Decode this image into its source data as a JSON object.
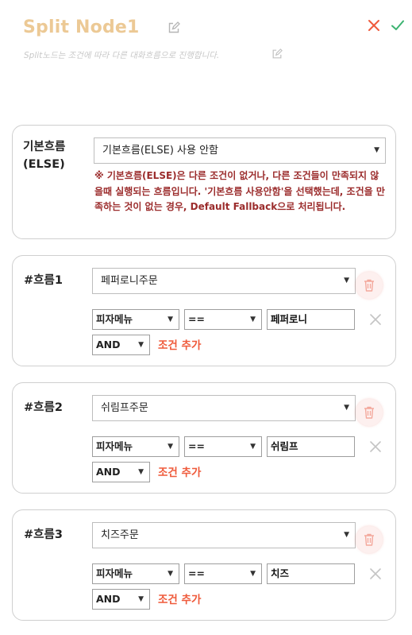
{
  "header": {
    "title": "Split Node1",
    "subtitle": "Split노드는 조건에 따라 다른 대화흐름으로 진행합니다.",
    "icons": {
      "title_edit": "edit-icon",
      "subtitle_edit": "edit-icon",
      "close": "close-icon",
      "confirm": "check-icon"
    },
    "colors": {
      "title": "#ecc995",
      "close": "#ef5a3b",
      "confirm": "#3cb371"
    }
  },
  "default_flow": {
    "label_line1": "기본흐름",
    "label_line2": "(ELSE)",
    "selected": "기본흐름(ELSE) 사용 안함",
    "warning": "※ 기본흐름(ELSE)은 다른 조건이 없거나, 다른 조건들이 만족되지 않을때 실행되는 흐름입니다. '기본흐름 사용안함'을 선택했는데, 조건을 만족하는 것이 없는 경우, Default Fallback으로 처리됩니다."
  },
  "flows": [
    {
      "label": "#흐름1",
      "target": "페퍼로니주문",
      "variable": "피자메뉴",
      "operator": "==",
      "value": "페퍼로니",
      "conjunction": "AND",
      "add_condition": "조건 추가"
    },
    {
      "label": "#흐름2",
      "target": "쉬림프주문",
      "variable": "피자메뉴",
      "operator": "==",
      "value": "쉬림프",
      "conjunction": "AND",
      "add_condition": "조건 추가"
    },
    {
      "label": "#흐름3",
      "target": "치즈주문",
      "variable": "피자메뉴",
      "operator": "==",
      "value": "치즈",
      "conjunction": "AND",
      "add_condition": "조건 추가"
    }
  ]
}
